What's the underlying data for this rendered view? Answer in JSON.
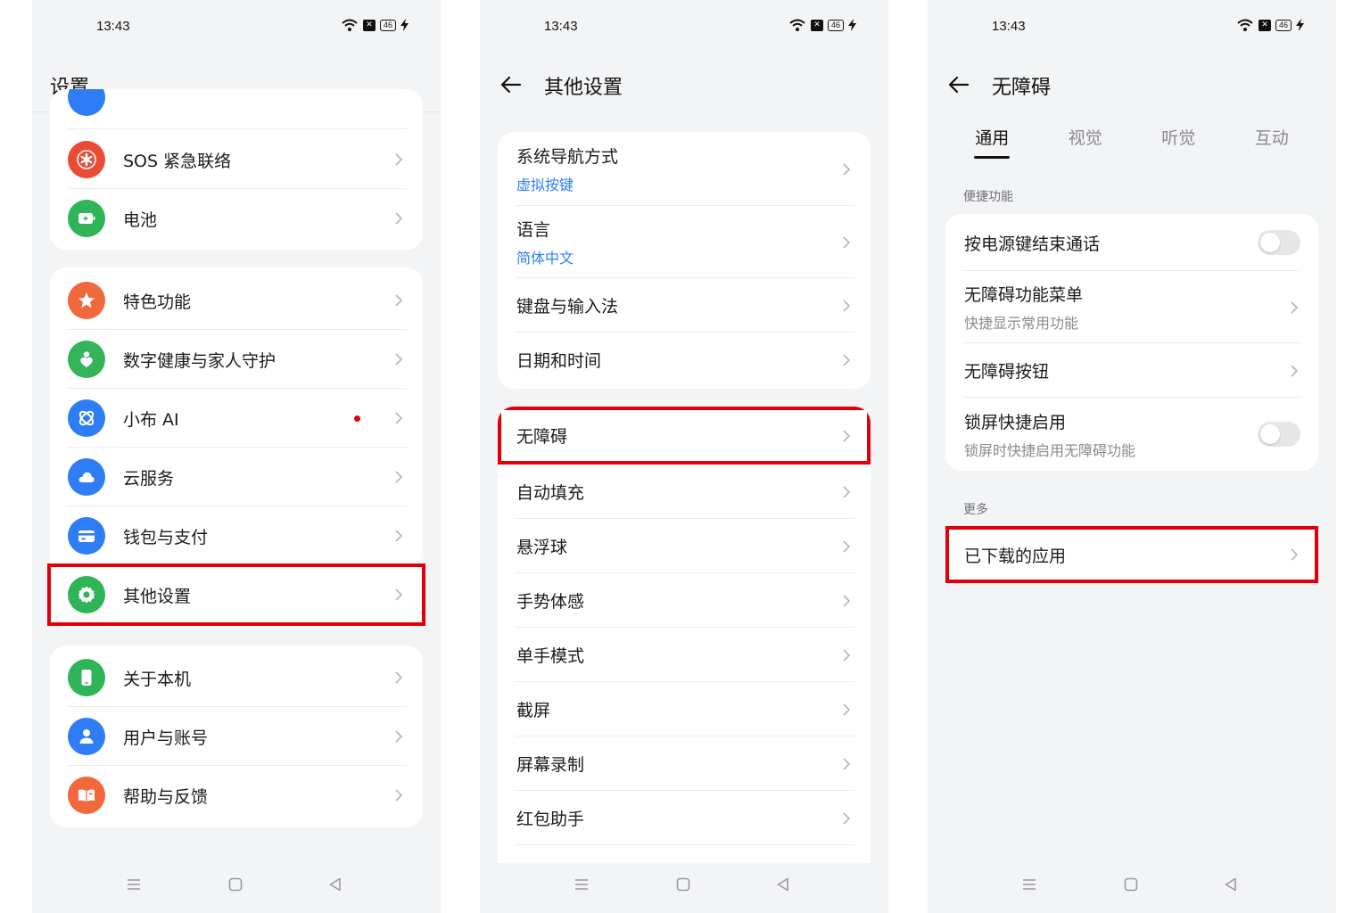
{
  "status": {
    "time": "13:43",
    "battery": "46"
  },
  "screen1": {
    "title": "设置",
    "group1": [
      {
        "label": "SOS 紧急联络",
        "icon": "sos-asterisk-icon",
        "color": "#ea4b35"
      },
      {
        "label": "电池",
        "icon": "battery-charging-icon",
        "color": "#2fb457"
      }
    ],
    "group2": [
      {
        "label": "特色功能",
        "icon": "star-icon",
        "color": "#f2683d"
      },
      {
        "label": "数字健康与家人守护",
        "icon": "heart-person-icon",
        "color": "#34b35a"
      },
      {
        "label": "小布 AI",
        "icon": "ai-assistant-icon",
        "color": "#2e7df5"
      },
      {
        "label": "云服务",
        "icon": "cloud-icon",
        "color": "#2e7df5"
      },
      {
        "label": "钱包与支付",
        "icon": "wallet-card-icon",
        "color": "#2e7df5"
      },
      {
        "label": "其他设置",
        "icon": "gear-icon",
        "color": "#2fb457"
      }
    ],
    "group3": [
      {
        "label": "关于本机",
        "icon": "phone-device-icon",
        "color": "#2fb457"
      },
      {
        "label": "用户与账号",
        "icon": "user-icon",
        "color": "#2e7df5"
      },
      {
        "label": "帮助与反馈",
        "icon": "help-book-icon",
        "color": "#f2683d"
      }
    ]
  },
  "screen2": {
    "title": "其他设置",
    "group1": [
      {
        "label": "系统导航方式",
        "sub": "虚拟按键"
      },
      {
        "label": "语言",
        "sub": "简体中文"
      },
      {
        "label": "键盘与输入法"
      },
      {
        "label": "日期和时间"
      }
    ],
    "group2": [
      {
        "label": "无障碍"
      },
      {
        "label": "自动填充"
      },
      {
        "label": "悬浮球"
      },
      {
        "label": "手势体感"
      },
      {
        "label": "单手模式"
      },
      {
        "label": "截屏"
      },
      {
        "label": "屏幕录制"
      },
      {
        "label": "红包助手"
      }
    ]
  },
  "screen3": {
    "title": "无障碍",
    "tabs": [
      "通用",
      "视觉",
      "听觉",
      "互动"
    ],
    "section1": "便捷功能",
    "group1": [
      {
        "label": "按电源键结束通话",
        "toggle": "off"
      },
      {
        "label": "无障碍功能菜单",
        "sub": "快捷显示常用功能"
      },
      {
        "label": "无障碍按钮"
      },
      {
        "label": "锁屏快捷启用",
        "sub": "锁屏时快捷启用无障碍功能",
        "toggle": "off"
      }
    ],
    "section2": "更多",
    "group2": [
      {
        "label": "已下载的应用"
      }
    ]
  },
  "colors": {
    "highlight": "#e1000a",
    "link": "#2e7df5",
    "notification_dot": "#e1000a"
  }
}
